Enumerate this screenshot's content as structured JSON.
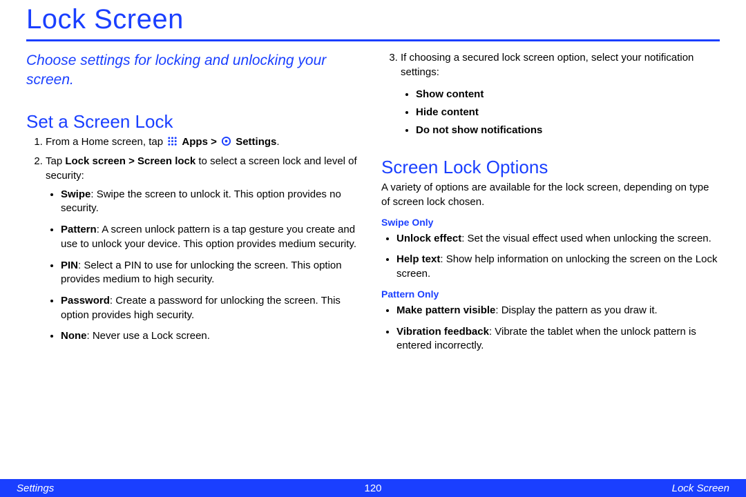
{
  "page_title": "Lock Screen",
  "intro": "Choose settings for locking and unlocking your screen.",
  "left": {
    "section_title": "Set a Screen Lock",
    "step1_a": "From a Home screen, tap",
    "step1_apps": "Apps >",
    "step1_settings": "Settings",
    "step1_end": ".",
    "step2_a": "Tap ",
    "step2_b": "Lock screen > Screen lock",
    "step2_c": " to select a screen lock and level of security:",
    "options": {
      "swipe_h": "Swipe",
      "swipe_t": ": Swipe the screen to unlock it. This option provides no security.",
      "pattern_h": "Pattern",
      "pattern_t": ": A screen unlock pattern is a tap gesture you create and use to unlock your device. This option provides medium security.",
      "pin_h": "PIN",
      "pin_t": ": Select a PIN to use for unlocking the screen. This option provides medium to high security.",
      "password_h": "Password",
      "password_t": ": Create a password for unlocking the screen. This option provides high security.",
      "none_h": "None",
      "none_t": ": Never use a Lock screen."
    }
  },
  "right": {
    "step3": "If choosing a secured lock screen option, select your notification settings:",
    "notif": {
      "a": "Show content",
      "b": "Hide content",
      "c": "Do not show notifications"
    },
    "section_title": "Screen Lock Options",
    "intro": "A variety of options are available for the lock screen, depending on type of screen lock chosen.",
    "swipe_only": "Swipe Only",
    "swipe_opts": {
      "unlock_h": "Unlock effect",
      "unlock_t": ": Set the visual effect used when unlocking the screen.",
      "help_h": "Help text",
      "help_t": ": Show help information on unlocking the screen on the Lock screen."
    },
    "pattern_only": "Pattern Only",
    "pattern_opts": {
      "vis_h": "Make pattern visible",
      "vis_t": ": Display the pattern as you draw it.",
      "vib_h": "Vibration feedback",
      "vib_t": ": Vibrate the tablet when the unlock pattern is entered incorrectly."
    }
  },
  "footer": {
    "left": "Settings",
    "center": "120",
    "right": "Lock Screen"
  }
}
